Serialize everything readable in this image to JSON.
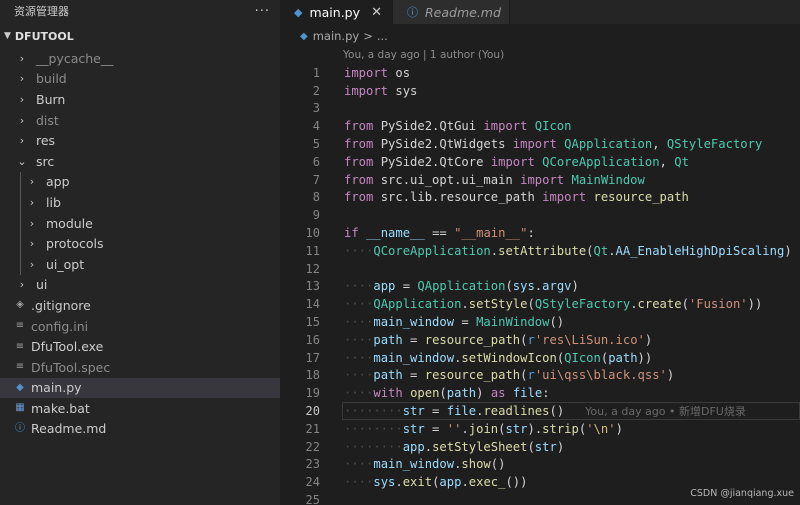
{
  "sidebar": {
    "title": "资源管理器",
    "more": "···",
    "section": "DFUTOOL",
    "items": [
      {
        "label": "__pycache__",
        "type": "folder",
        "expanded": false,
        "dim": true,
        "depth": 0
      },
      {
        "label": "build",
        "type": "folder",
        "expanded": false,
        "dim": true,
        "depth": 0
      },
      {
        "label": "Burn",
        "type": "folder",
        "expanded": false,
        "dim": false,
        "depth": 0
      },
      {
        "label": "dist",
        "type": "folder",
        "expanded": false,
        "dim": true,
        "depth": 0
      },
      {
        "label": "res",
        "type": "folder",
        "expanded": false,
        "dim": false,
        "depth": 0
      },
      {
        "label": "src",
        "type": "folder",
        "expanded": true,
        "dim": false,
        "depth": 0
      },
      {
        "label": "app",
        "type": "folder",
        "expanded": false,
        "dim": false,
        "depth": 1
      },
      {
        "label": "lib",
        "type": "folder",
        "expanded": false,
        "dim": false,
        "depth": 1
      },
      {
        "label": "module",
        "type": "folder",
        "expanded": false,
        "dim": false,
        "depth": 1
      },
      {
        "label": "protocols",
        "type": "folder",
        "expanded": false,
        "dim": false,
        "depth": 1
      },
      {
        "label": "ui_opt",
        "type": "folder",
        "expanded": false,
        "dim": false,
        "depth": 1
      },
      {
        "label": "ui",
        "type": "folder",
        "expanded": false,
        "dim": false,
        "depth": 0
      },
      {
        "label": ".gitignore",
        "type": "git",
        "dim": false,
        "depth": 0
      },
      {
        "label": "config.ini",
        "type": "cfg",
        "dim": true,
        "depth": 0
      },
      {
        "label": "DfuTool.exe",
        "type": "cfg",
        "dim": false,
        "depth": 0
      },
      {
        "label": "DfuTool.spec",
        "type": "cfg",
        "dim": true,
        "depth": 0
      },
      {
        "label": "main.py",
        "type": "py",
        "dim": false,
        "depth": 0,
        "active": true
      },
      {
        "label": "make.bat",
        "type": "bat",
        "dim": false,
        "depth": 0
      },
      {
        "label": "Readme.md",
        "type": "info",
        "dim": false,
        "depth": 0
      }
    ]
  },
  "tabs": [
    {
      "label": "main.py",
      "active": true,
      "icon": "python-icon",
      "close": "✕"
    },
    {
      "label": "Readme.md",
      "active": false,
      "icon": "info-icon"
    }
  ],
  "breadcrumb": {
    "file": "main.py",
    "sep": ">",
    "more": "..."
  },
  "editor": {
    "codelens": "You, a day ago | 1 author (You)",
    "current_line": 20,
    "blame": "You, a day ago • 新增DFU烧录",
    "lines": [
      [
        [
          "kw",
          "import"
        ],
        [
          "p",
          " os"
        ]
      ],
      [
        [
          "kw",
          "import"
        ],
        [
          "p",
          " sys"
        ]
      ],
      [],
      [
        [
          "kw",
          "from"
        ],
        [
          "p",
          " PySide2.QtGui "
        ],
        [
          "kw",
          "import"
        ],
        [
          "p",
          " "
        ],
        [
          "cls",
          "QIcon"
        ]
      ],
      [
        [
          "kw",
          "from"
        ],
        [
          "p",
          " PySide2.QtWidgets "
        ],
        [
          "kw",
          "import"
        ],
        [
          "p",
          " "
        ],
        [
          "cls",
          "QApplication"
        ],
        [
          "p",
          ", "
        ],
        [
          "cls",
          "QStyleFactory"
        ]
      ],
      [
        [
          "kw",
          "from"
        ],
        [
          "p",
          " PySide2.QtCore "
        ],
        [
          "kw",
          "import"
        ],
        [
          "p",
          " "
        ],
        [
          "cls",
          "QCoreApplication"
        ],
        [
          "p",
          ", "
        ],
        [
          "cls",
          "Qt"
        ]
      ],
      [
        [
          "kw",
          "from"
        ],
        [
          "p",
          " src.ui_opt.ui_main "
        ],
        [
          "kw",
          "import"
        ],
        [
          "p",
          " "
        ],
        [
          "cls",
          "MainWindow"
        ]
      ],
      [
        [
          "kw",
          "from"
        ],
        [
          "p",
          " src.lib.resource_path "
        ],
        [
          "kw",
          "import"
        ],
        [
          "p",
          " "
        ],
        [
          "fn",
          "resource_path"
        ]
      ],
      [],
      [
        [
          "kw",
          "if"
        ],
        [
          "p",
          " "
        ],
        [
          "var",
          "__name__"
        ],
        [
          "p",
          " == "
        ],
        [
          "str",
          "\"__main__\""
        ],
        [
          "p",
          ":"
        ]
      ],
      [
        [
          "dot",
          "····"
        ],
        [
          "cls",
          "QCoreApplication"
        ],
        [
          "p",
          "."
        ],
        [
          "fn",
          "setAttribute"
        ],
        [
          "p",
          "("
        ],
        [
          "cls",
          "Qt"
        ],
        [
          "p",
          "."
        ],
        [
          "var",
          "AA_EnableHighDpiScaling"
        ],
        [
          "p",
          ")"
        ]
      ],
      [],
      [
        [
          "dot",
          "····"
        ],
        [
          "var",
          "app"
        ],
        [
          "p",
          " = "
        ],
        [
          "cls",
          "QApplication"
        ],
        [
          "p",
          "("
        ],
        [
          "var",
          "sys"
        ],
        [
          "p",
          "."
        ],
        [
          "var",
          "argv"
        ],
        [
          "p",
          ")"
        ]
      ],
      [
        [
          "dot",
          "····"
        ],
        [
          "cls",
          "QApplication"
        ],
        [
          "p",
          "."
        ],
        [
          "fn",
          "setStyle"
        ],
        [
          "p",
          "("
        ],
        [
          "cls",
          "QStyleFactory"
        ],
        [
          "p",
          "."
        ],
        [
          "fn",
          "create"
        ],
        [
          "p",
          "("
        ],
        [
          "str",
          "'Fusion'"
        ],
        [
          "p",
          "))"
        ]
      ],
      [
        [
          "dot",
          "····"
        ],
        [
          "var",
          "main_window"
        ],
        [
          "p",
          " = "
        ],
        [
          "cls",
          "MainWindow"
        ],
        [
          "p",
          "()"
        ]
      ],
      [
        [
          "dot",
          "····"
        ],
        [
          "var",
          "path"
        ],
        [
          "p",
          " = "
        ],
        [
          "fn",
          "resource_path"
        ],
        [
          "p",
          "("
        ],
        [
          "kw2",
          "r"
        ],
        [
          "str",
          "'res\\LiSun.ico'"
        ],
        [
          "p",
          ")"
        ]
      ],
      [
        [
          "dot",
          "····"
        ],
        [
          "var",
          "main_window"
        ],
        [
          "p",
          "."
        ],
        [
          "fn",
          "setWindowIcon"
        ],
        [
          "p",
          "("
        ],
        [
          "cls",
          "QIcon"
        ],
        [
          "p",
          "("
        ],
        [
          "var",
          "path"
        ],
        [
          "p",
          "))"
        ]
      ],
      [
        [
          "dot",
          "····"
        ],
        [
          "var",
          "path"
        ],
        [
          "p",
          " = "
        ],
        [
          "fn",
          "resource_path"
        ],
        [
          "p",
          "("
        ],
        [
          "kw2",
          "r"
        ],
        [
          "str",
          "'ui\\qss\\black.qss'"
        ],
        [
          "p",
          ")"
        ]
      ],
      [
        [
          "dot",
          "····"
        ],
        [
          "kw",
          "with"
        ],
        [
          "p",
          " "
        ],
        [
          "fn",
          "open"
        ],
        [
          "p",
          "("
        ],
        [
          "var",
          "path"
        ],
        [
          "p",
          ") "
        ],
        [
          "kw",
          "as"
        ],
        [
          "p",
          " "
        ],
        [
          "var",
          "file"
        ],
        [
          "p",
          ":"
        ]
      ],
      [
        [
          "dot",
          "········"
        ],
        [
          "var",
          "str"
        ],
        [
          "p",
          " = "
        ],
        [
          "var",
          "file"
        ],
        [
          "p",
          "."
        ],
        [
          "fn",
          "readlines"
        ],
        [
          "p",
          "()"
        ]
      ],
      [
        [
          "dot",
          "········"
        ],
        [
          "var",
          "str"
        ],
        [
          "p",
          " = "
        ],
        [
          "str",
          "''"
        ],
        [
          "p",
          "."
        ],
        [
          "fn",
          "join"
        ],
        [
          "p",
          "("
        ],
        [
          "var",
          "str"
        ],
        [
          "p",
          ")."
        ],
        [
          "fn",
          "strip"
        ],
        [
          "p",
          "("
        ],
        [
          "str",
          "'"
        ],
        [
          "esc",
          "\\n"
        ],
        [
          "str",
          "'"
        ],
        [
          "p",
          ")"
        ]
      ],
      [
        [
          "dot",
          "········"
        ],
        [
          "var",
          "app"
        ],
        [
          "p",
          "."
        ],
        [
          "fn",
          "setStyleSheet"
        ],
        [
          "p",
          "("
        ],
        [
          "var",
          "str"
        ],
        [
          "p",
          ")"
        ]
      ],
      [
        [
          "dot",
          "····"
        ],
        [
          "var",
          "main_window"
        ],
        [
          "p",
          "."
        ],
        [
          "fn",
          "show"
        ],
        [
          "p",
          "()"
        ]
      ],
      [
        [
          "dot",
          "····"
        ],
        [
          "var",
          "sys"
        ],
        [
          "p",
          "."
        ],
        [
          "fn",
          "exit"
        ],
        [
          "p",
          "("
        ],
        [
          "var",
          "app"
        ],
        [
          "p",
          "."
        ],
        [
          "fn",
          "exec_"
        ],
        [
          "p",
          "())"
        ]
      ],
      []
    ]
  },
  "watermark": "CSDN @jianqiang.xue"
}
